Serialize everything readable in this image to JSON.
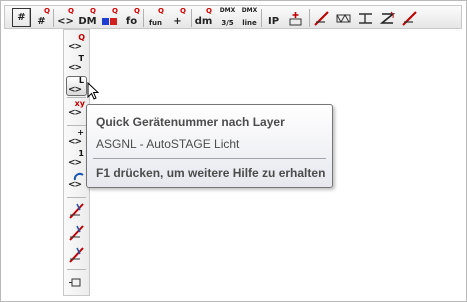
{
  "toolbar": {
    "items": [
      {
        "name": "grid-toggle-button",
        "main": "#",
        "sup": "",
        "sub": "",
        "icon": "hash-icon"
      },
      {
        "name": "quick-hash-button",
        "main": "#",
        "sup": "Q",
        "sub": "",
        "icon": "hash-q-icon"
      },
      {
        "name": "quick-tag-button",
        "main": "<>",
        "sup": "Q",
        "sub": "",
        "icon": "tag-q-icon"
      },
      {
        "name": "quick-dm-button",
        "main": "DM",
        "sup": "Q",
        "sub": "",
        "icon": "dm-q-icon"
      },
      {
        "name": "quick-color-button",
        "main": "",
        "sup": "Q",
        "sub": "",
        "icon": "color-blocks-icon"
      },
      {
        "name": "quick-fo-button",
        "main": "fo",
        "sup": "Q",
        "sub": "",
        "icon": "fo-q-icon"
      },
      {
        "name": "quick-fun-button",
        "main": "fun",
        "sup": "Q",
        "sub": "",
        "icon": "fun-q-icon"
      },
      {
        "name": "quick-plus-button",
        "main": "+",
        "sup": "Q",
        "sub": "",
        "icon": "plus-q-icon"
      },
      {
        "name": "quick-dm-number-button",
        "main": "dm",
        "sup": "Q",
        "sub": "",
        "icon": "dm-number-icon"
      },
      {
        "name": "dmx-address-button",
        "main": "3/5",
        "sup": "",
        "sub": "DMX",
        "icon": "dmx-address-icon"
      },
      {
        "name": "dmx-line-button",
        "main": "line",
        "sup": "",
        "sub": "DMX",
        "icon": "dmx-line-icon"
      },
      {
        "name": "ip-button",
        "main": "IP",
        "sup": "",
        "sub": "",
        "icon": "ip-icon"
      },
      {
        "name": "insert-symbol-button",
        "main": "+",
        "sup": "",
        "sub": "",
        "icon": "insert-symbol-icon"
      },
      {
        "name": "strike-tool-button",
        "main": "",
        "sup": "",
        "sub": "",
        "icon": "strike-icon"
      },
      {
        "name": "truss-tool-button",
        "main": "",
        "sup": "",
        "sub": "",
        "icon": "truss-icon"
      },
      {
        "name": "align-tool-button",
        "main": "",
        "sup": "",
        "sub": "",
        "icon": "align-icon"
      },
      {
        "name": "rotate-tool-button",
        "main": "",
        "sup": "",
        "sub": "",
        "icon": "rotate-icon"
      },
      {
        "name": "no-draw-button",
        "main": "",
        "sup": "",
        "sub": "",
        "icon": "no-draw-icon"
      }
    ]
  },
  "flyout": {
    "buttons": [
      {
        "name": "quick-tag-q-button",
        "base": "<>",
        "sup": "Q",
        "icon": "tag-q-icon"
      },
      {
        "name": "quick-tag-t-button",
        "base": "<>",
        "sup": "T",
        "icon": "tag-t-icon"
      },
      {
        "name": "quick-tag-l-button",
        "base": "<>",
        "sup": "L",
        "icon": "tag-l-icon"
      },
      {
        "name": "quick-tag-xy-button",
        "base": "<>",
        "sup": "xy",
        "icon": "tag-xy-icon"
      },
      {
        "name": "quick-tag-plus-button",
        "base": "<>",
        "sup": "+",
        "icon": "tag-plus-icon"
      },
      {
        "name": "quick-tag-one-button",
        "base": "<>",
        "sup": "1",
        "icon": "tag-one-icon"
      },
      {
        "name": "quick-tag-rotate-button",
        "base": "<>",
        "sup": "",
        "icon": "tag-rotate-icon"
      },
      {
        "name": "strike-edit-1-button",
        "base": "",
        "sup": "",
        "icon": "strike-edit-icon"
      },
      {
        "name": "strike-edit-2-button",
        "base": "",
        "sup": "",
        "icon": "strike-edit-icon"
      },
      {
        "name": "strike-edit-3-button",
        "base": "",
        "sup": "",
        "icon": "strike-edit-icon"
      },
      {
        "name": "pin-button",
        "base": "",
        "sup": "",
        "icon": "pin-icon"
      }
    ]
  },
  "tooltip": {
    "title": "Quick Gerätenummer nach Layer",
    "description": "ASGNL - AutoSTAGE Licht",
    "help": "F1 drücken, um weitere Hilfe zu erhalten"
  },
  "colors": {
    "accent_red": "#d00000",
    "tooltip_text": "#4c4c4c"
  }
}
